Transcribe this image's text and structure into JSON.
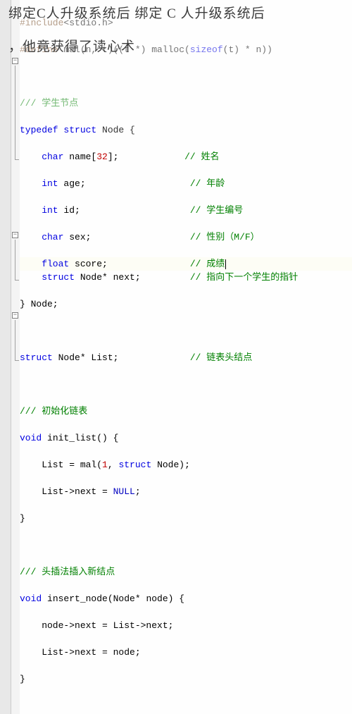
{
  "overlay": {
    "line1": "绑定C人升级系统后 绑定 C 人升级系统后",
    "line2": "，他竟获得了读心术"
  },
  "code": {
    "l1a": "#include",
    "l1b": "<stdio.h>",
    "l2a": "#define",
    "l2b": " mal(n, t)((t *) malloc(",
    "l2c": "sizeof",
    "l2d": "(t) * n))",
    "l3": "",
    "l4": "/// 学生节点",
    "l5a": "typedef",
    "l5b": " struct",
    "l5c": " Node {",
    "l6a": "    char",
    "l6b": " name[",
    "l6c": "32",
    "l6d": "];",
    "l6cmt": "// 姓名",
    "l7a": "    int",
    "l7b": " age;",
    "l7cmt": "// 年龄",
    "l8a": "    int",
    "l8b": " id;",
    "l8cmt": "// 学生编号",
    "l9a": "    char",
    "l9b": " sex;",
    "l9cmt": "// 性别（M/F）",
    "l10a": "    float",
    "l10b": " score;",
    "l10cmt": "// 成绩",
    "l11a": "    struct",
    "l11b": " Node* next;",
    "l11cmt": "// 指向下一个学生的指针",
    "l12": "} Node;",
    "l13": "",
    "l14a": "struct",
    "l14b": " Node* List;",
    "l14cmt": "// 链表头结点",
    "l15": "",
    "l16": "/// 初始化链表",
    "l17a": "void",
    "l17b": " init_list() {",
    "l18a": "    List = mal(",
    "l18b": "1",
    "l18c": ", ",
    "l18d": "struct",
    "l18e": " Node);",
    "l19a": "    List->next = ",
    "l19b": "NULL",
    "l19c": ";",
    "l20": "}",
    "l21": "",
    "l22": "/// 头插法插入新结点",
    "l23a": "void",
    "l23b": " insert_node(Node* node) {",
    "l24": "    node->next = List->next;",
    "l25": "    List->next = node;",
    "l26": "}"
  },
  "fold": {
    "minus": "−"
  }
}
